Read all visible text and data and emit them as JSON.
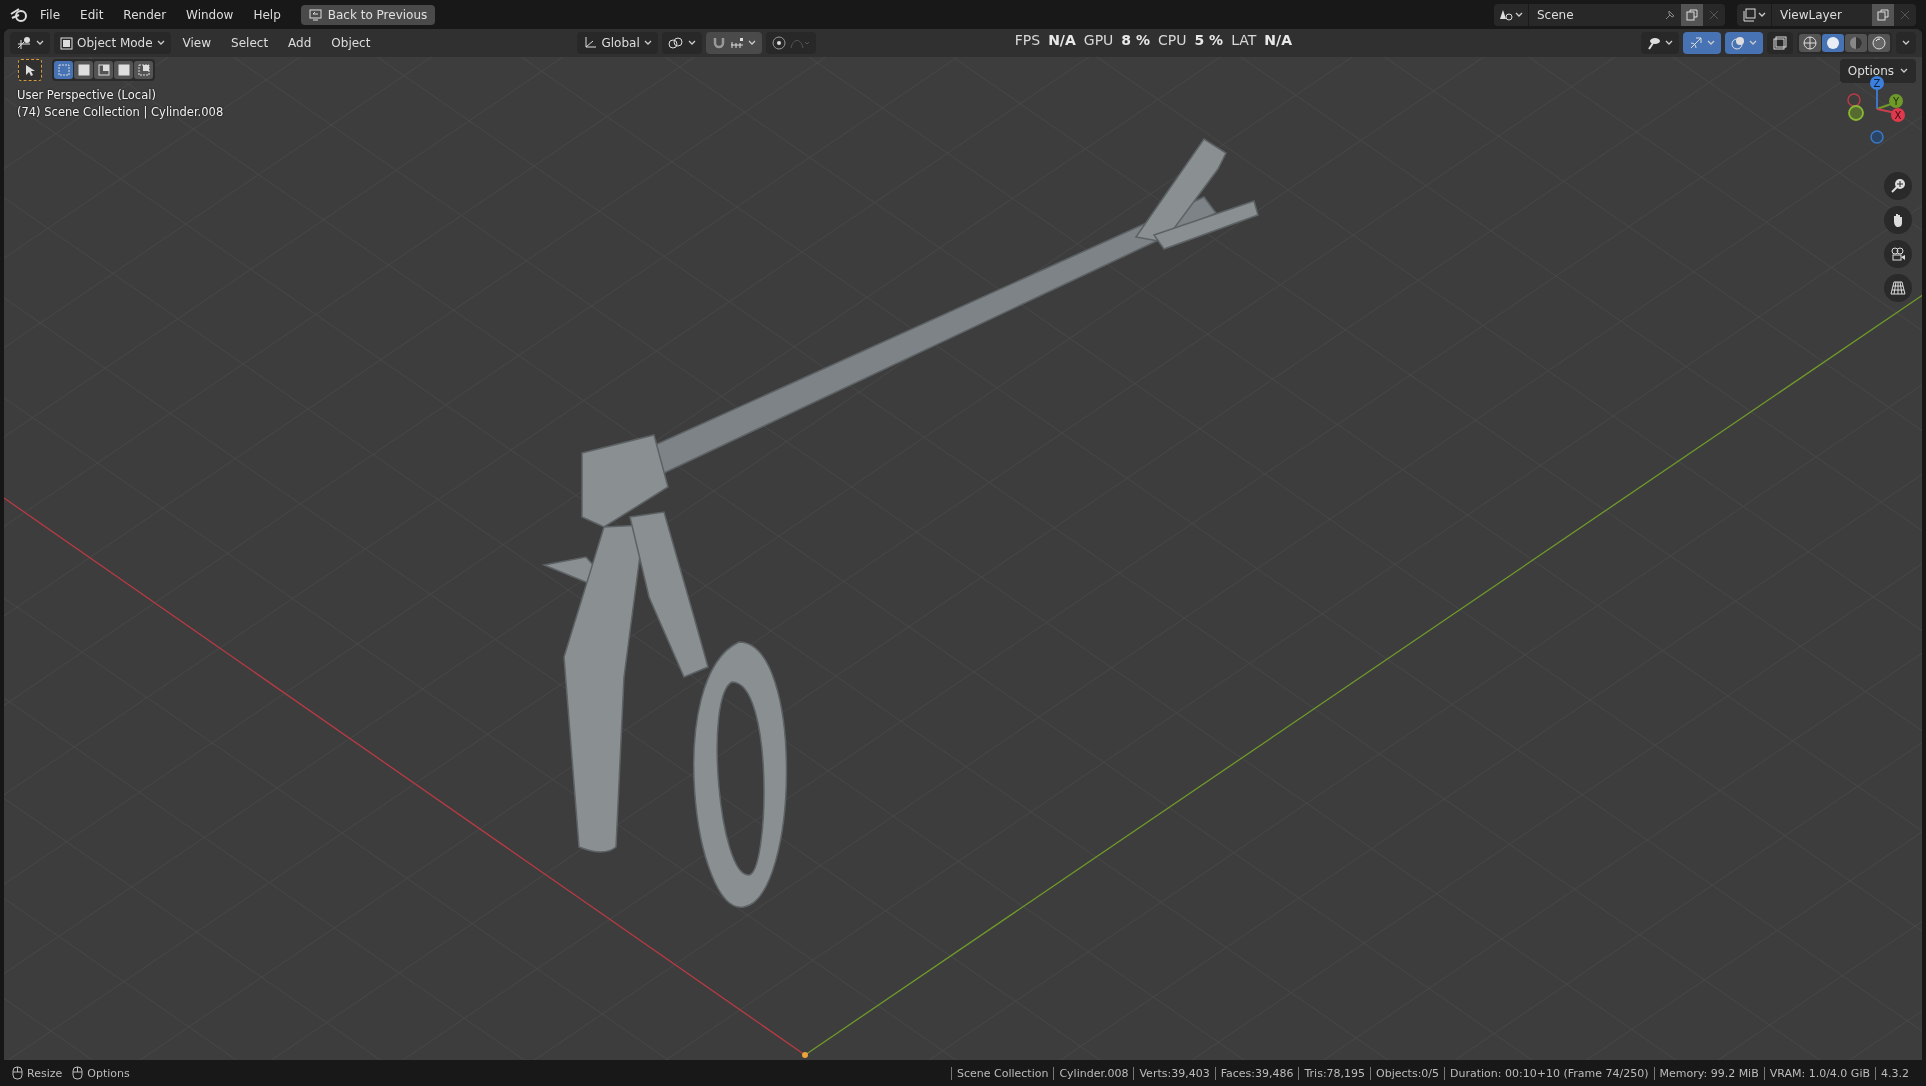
{
  "menu": [
    "File",
    "Edit",
    "Render",
    "Window",
    "Help"
  ],
  "back_button": "Back to Previous",
  "scene": {
    "name": "Scene"
  },
  "view_layer": {
    "name": "ViewLayer"
  },
  "header": {
    "mode": "Object Mode",
    "menus": [
      "View",
      "Select",
      "Add",
      "Object"
    ],
    "orientation": "Global",
    "snap_on": false,
    "gizmos_on": true,
    "overlays_on": true
  },
  "stats": [
    {
      "label": "FPS",
      "value": "N/A"
    },
    {
      "label": "GPU",
      "value": "8 %"
    },
    {
      "label": "CPU",
      "value": "5 %"
    },
    {
      "label": "LAT",
      "value": "N/A"
    }
  ],
  "select_modes": [
    {
      "selected": true
    },
    {
      "selected": false
    },
    {
      "selected": false
    },
    {
      "selected": false
    },
    {
      "selected": false
    }
  ],
  "shading": [
    {
      "selected": false
    },
    {
      "selected": true
    },
    {
      "selected": false
    },
    {
      "selected": false
    }
  ],
  "viewport": {
    "title": "User Perspective (Local)",
    "context": "(74) Scene Collection | Cylinder.008",
    "options": "Options"
  },
  "gizmo": {
    "z": "Z",
    "y": "Y",
    "x": "X"
  },
  "status_bar": {
    "hints": [
      "Resize",
      "Options"
    ],
    "stats": [
      "Scene Collection",
      "Cylinder.008",
      "Verts:39,403",
      "Faces:39,486",
      "Tris:78,195",
      "Objects:0/5",
      "Duration: 00:10+10 (Frame 74/250)",
      "Memory: 99.2 MiB",
      "VRAM: 1.0/4.0 GiB",
      "4.3.2"
    ]
  }
}
